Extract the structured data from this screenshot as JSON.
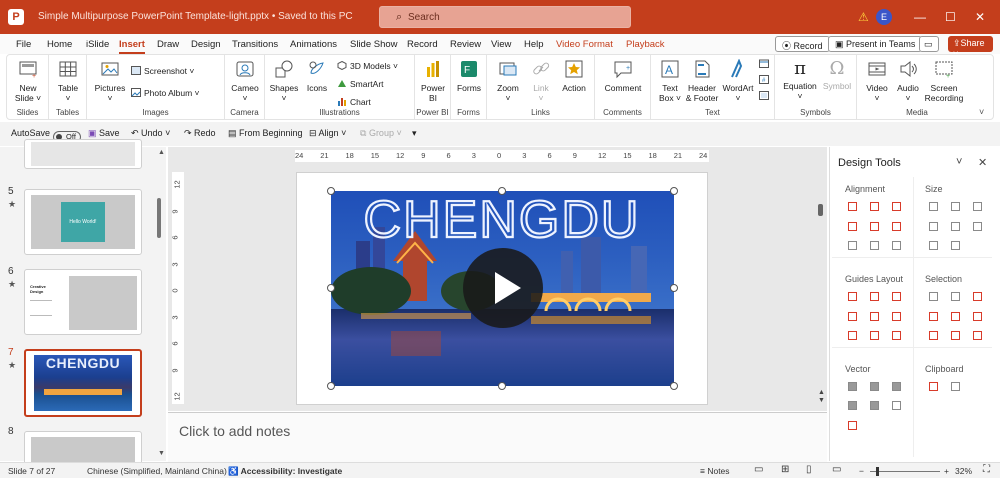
{
  "titlebar": {
    "app_logo": "P",
    "document_title": "Simple Multipurpose PowerPoint Template-light.pptx • Saved to this PC",
    "search_placeholder": "Search",
    "user_initial": "E",
    "warning_icon": "warning-icon",
    "window_controls": [
      "—",
      "☐",
      "✕"
    ]
  },
  "menu_tabs": [
    "File",
    "Home",
    "iSlide",
    "Insert",
    "Draw",
    "Design",
    "Transitions",
    "Animations",
    "Slide Show",
    "Record",
    "Review",
    "View",
    "Help",
    "Video Format",
    "Playback"
  ],
  "active_tab": "Insert",
  "header_buttons": {
    "record": "Record",
    "present_in_teams": "Present in Teams",
    "share": "Share"
  },
  "ribbon": {
    "groups": [
      {
        "label": "Slides",
        "items": [
          "New\nSlide ˅"
        ]
      },
      {
        "label": "Tables",
        "items": [
          "Table\n˅"
        ]
      },
      {
        "label": "Images",
        "items": [
          "Pictures\n˅",
          "Screenshot ˅",
          "Photo Album ˅"
        ]
      },
      {
        "label": "Camera",
        "items": [
          "Cameo\n˅"
        ]
      },
      {
        "label": "Illustrations",
        "items": [
          "Shapes\n˅",
          "Icons",
          "3D Models ˅",
          "SmartArt",
          "Chart"
        ]
      },
      {
        "label": "Power BI",
        "items": [
          "Power\nBI"
        ]
      },
      {
        "label": "Forms",
        "items": [
          "Forms"
        ]
      },
      {
        "label": "Links",
        "items": [
          "Zoom\n˅",
          "Link\n˅",
          "Action"
        ]
      },
      {
        "label": "Comments",
        "items": [
          "Comment"
        ]
      },
      {
        "label": "Text",
        "items": [
          "Text\nBox ˅",
          "Header\n& Footer",
          "WordArt\n˅"
        ]
      },
      {
        "label": "Symbols",
        "items": [
          "Equation\n˅",
          "Symbol"
        ]
      },
      {
        "label": "Media",
        "items": [
          "Video\n˅",
          "Audio\n˅",
          "Screen\nRecording"
        ]
      }
    ]
  },
  "qat": {
    "autosave": "AutoSave",
    "autosave_state": "Off",
    "save": "Save",
    "undo": "Undo",
    "redo": "Redo",
    "from_beginning": "From Beginning",
    "align": "Align",
    "group": "Group"
  },
  "thumbnails": [
    {
      "number": "5",
      "star": "★",
      "caption": "Hello World!"
    },
    {
      "number": "6",
      "star": "★",
      "caption": "Creative Design"
    },
    {
      "number": "7",
      "star": "★",
      "caption": "CHENGDU",
      "current": true
    },
    {
      "number": "8",
      "star": "",
      "caption": ""
    }
  ],
  "rulers": {
    "horizontal": [
      "24",
      "21",
      "18",
      "15",
      "12",
      "9",
      "6",
      "3",
      "0",
      "3",
      "6",
      "9",
      "12",
      "15",
      "18",
      "21",
      "24"
    ],
    "vertical": [
      "12",
      "9",
      "6",
      "3",
      "0",
      "3",
      "6",
      "9",
      "12"
    ]
  },
  "slide": {
    "video_title": "CHENGDU",
    "play_icon": "play-icon"
  },
  "notes_placeholder": "Click to add notes",
  "design_tools": {
    "title": "Design Tools",
    "sections": [
      "Alignment",
      "Size",
      "Guides Layout",
      "Selection",
      "Vector",
      "Clipboard"
    ]
  },
  "status": {
    "slide_info": "Slide 7 of 27",
    "language": "Chinese (Simplified, Mainland China)",
    "accessibility": "Accessibility: Investigate",
    "notes_button": "Notes",
    "zoom": "32%"
  },
  "colors": {
    "accent": "#c43e1c",
    "titlebar": "#c43e1c"
  }
}
